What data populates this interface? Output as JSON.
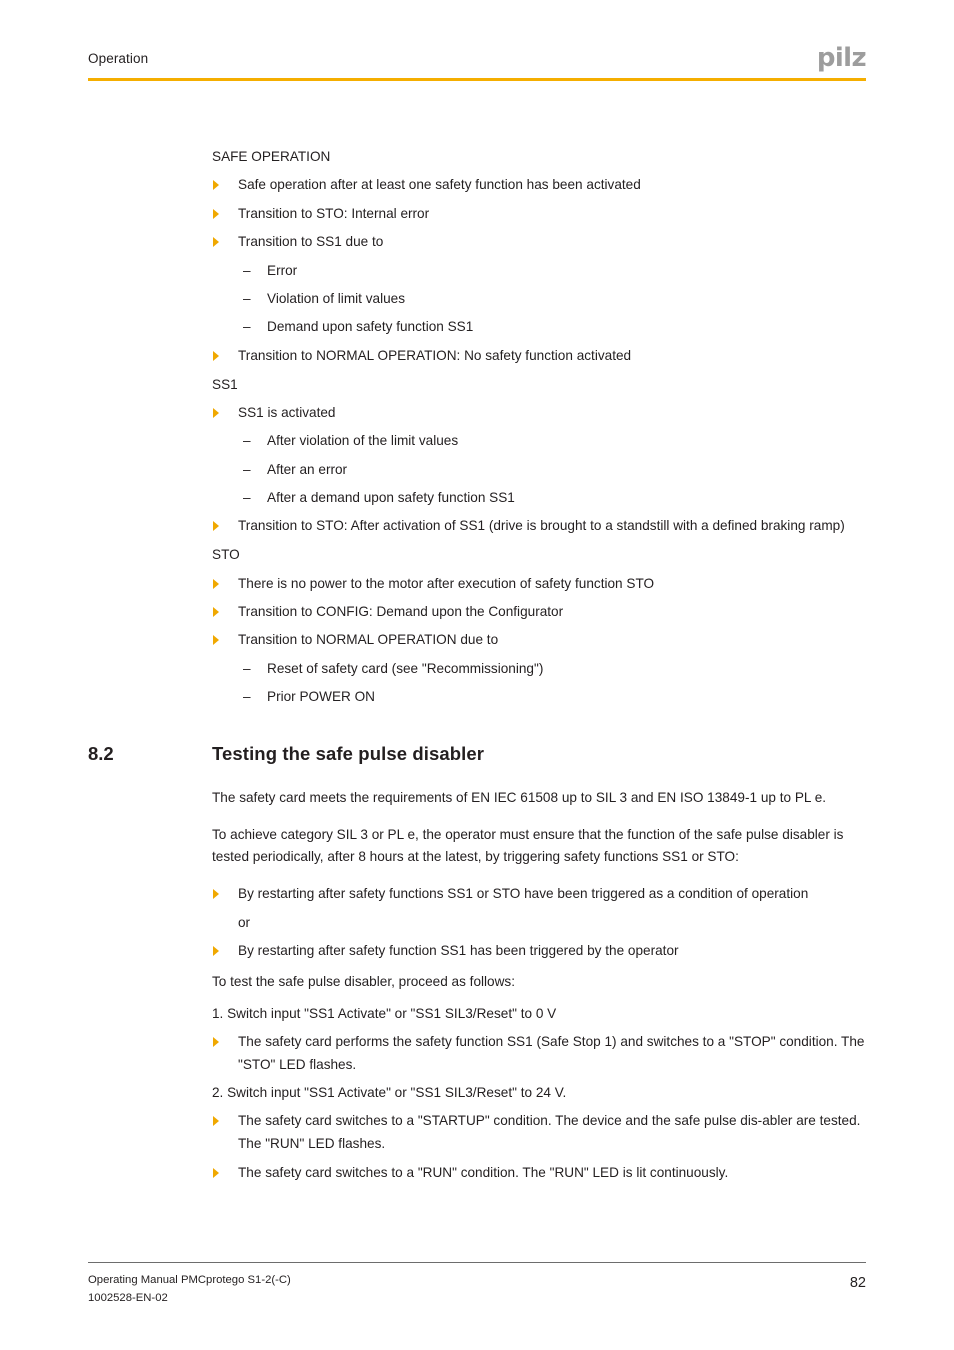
{
  "header": {
    "section_title": "Operation",
    "logo_text": "pilz",
    "rule_color": "#f5ae00"
  },
  "colors": {
    "bullet_marker": "#f0a800",
    "accent_rule": "#f5ae00",
    "logo_gray": "#9d9d9d",
    "text": "#231f20",
    "footer_rule": "#6d6d6d"
  },
  "content": {
    "groups": [
      {
        "label": "SAFE OPERATION",
        "items": [
          {
            "level": 1,
            "text": "Safe operation after at least one safety function has been activated"
          },
          {
            "level": 1,
            "text": "Transition to STO: Internal error"
          },
          {
            "level": 1,
            "text": "Transition to SS1 due to"
          },
          {
            "level": 2,
            "text": "Error"
          },
          {
            "level": 2,
            "text": "Violation of limit values"
          },
          {
            "level": 2,
            "text": "Demand upon safety function SS1"
          },
          {
            "level": 1,
            "text": "Transition to NORMAL OPERATION: No safety function activated"
          }
        ]
      },
      {
        "label": "SS1",
        "items": [
          {
            "level": 1,
            "text": "SS1 is activated"
          },
          {
            "level": 2,
            "text": "After violation of the limit values"
          },
          {
            "level": 2,
            "text": "After an error"
          },
          {
            "level": 2,
            "text": "After a demand upon safety function SS1"
          },
          {
            "level": 1,
            "text": "Transition to STO: After activation of SS1 (drive is brought to a standstill with a defined braking ramp)"
          }
        ]
      },
      {
        "label": "STO",
        "items": [
          {
            "level": 1,
            "text": "There is no power to the motor after execution of safety function STO"
          },
          {
            "level": 1,
            "text": "Transition to CONFIG: Demand upon the Configurator"
          },
          {
            "level": 1,
            "text": "Transition to NORMAL OPERATION due to"
          },
          {
            "level": 2,
            "text": "Reset of safety card (see \"Recommissioning\")"
          },
          {
            "level": 2,
            "text": "Prior POWER ON"
          }
        ]
      }
    ]
  },
  "section": {
    "number": "8.2",
    "title": "Testing the safe pulse disabler",
    "paragraphs": [
      "The safety card meets the requirements of EN IEC 61508 up to SIL 3 and EN ISO 13849-1 up to PL e.",
      "To achieve category SIL 3 or PL e, the operator must ensure that the function of the safe pulse disabler is tested periodically, after 8 hours at the latest, by triggering safety functions SS1 or STO:"
    ],
    "condition_bullets": [
      "By restarting after safety functions SS1 or STO have been triggered as a condition of operation"
    ],
    "or_label": "or",
    "condition_bullets_2": [
      "By restarting after safety function SS1 has been triggered by the operator"
    ],
    "procedure_intro": "To test the safe pulse disabler, proceed as follows:",
    "steps": [
      {
        "number": "1.",
        "text": "1. Switch input \"SS1 Activate\" or \"SS1 SIL3/Reset\" to 0 V",
        "results": [
          "The safety card performs the safety function SS1 (Safe Stop 1) and switches to a \"STOP\" condition. The \"STO\" LED flashes."
        ]
      },
      {
        "number": "2.",
        "text": "2. Switch input \"SS1 Activate\" or \"SS1 SIL3/Reset\" to 24 V.",
        "results": [
          "The safety card switches to a \"STARTUP\" condition. The device and the safe pulse dis-abler are tested. The \"RUN\" LED flashes.",
          "The safety card switches to a \"RUN\" condition. The \"RUN\" LED is lit continuously."
        ]
      }
    ]
  },
  "footer": {
    "manual_title": "Operating Manual PMCprotego S1-2(-C)",
    "document_id": "1002528-EN-02",
    "page_number": "82"
  }
}
